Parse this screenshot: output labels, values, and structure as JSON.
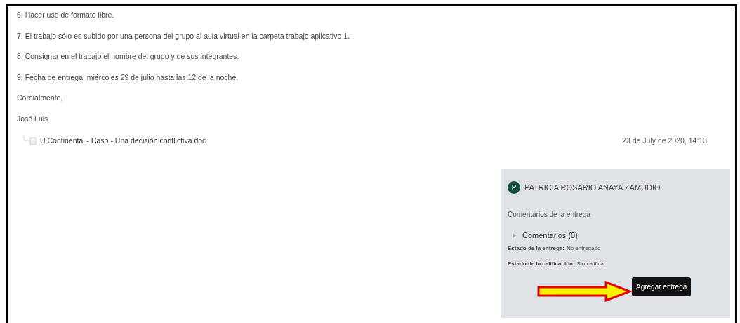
{
  "paragraphs": [
    "6. Hacer uso de formato libre.",
    "7. El trabajo sólo es subido por una persona del grupo al aula virtual en la carpeta trabajo aplicativo 1.",
    "8. Consignar en el trabajo el nombre del grupo y de sus integrantes.",
    "9. Fecha de entrega: miércoles 29 de julio hasta las 12 de la noche.",
    "Cordialmente,",
    "José Luis"
  ],
  "attachment": {
    "filename": "U Continental - Caso - Una decisión conflictiva.doc",
    "date": "23 de July de 2020, 14:13"
  },
  "submission": {
    "avatar_letter": "P",
    "user_name": "PATRICIA ROSARIO ANAYA ZAMUDIO",
    "section_title": "Comentarios de la entrega",
    "comments": {
      "label": "Comentarios (0)",
      "expanded": false
    },
    "status": [
      {
        "label": "Estado de la entrega:",
        "value": "No entregado"
      },
      {
        "label": "Estado de la calificación:",
        "value": "Sin calificar"
      }
    ],
    "tooltip": "Agregar entrega"
  }
}
